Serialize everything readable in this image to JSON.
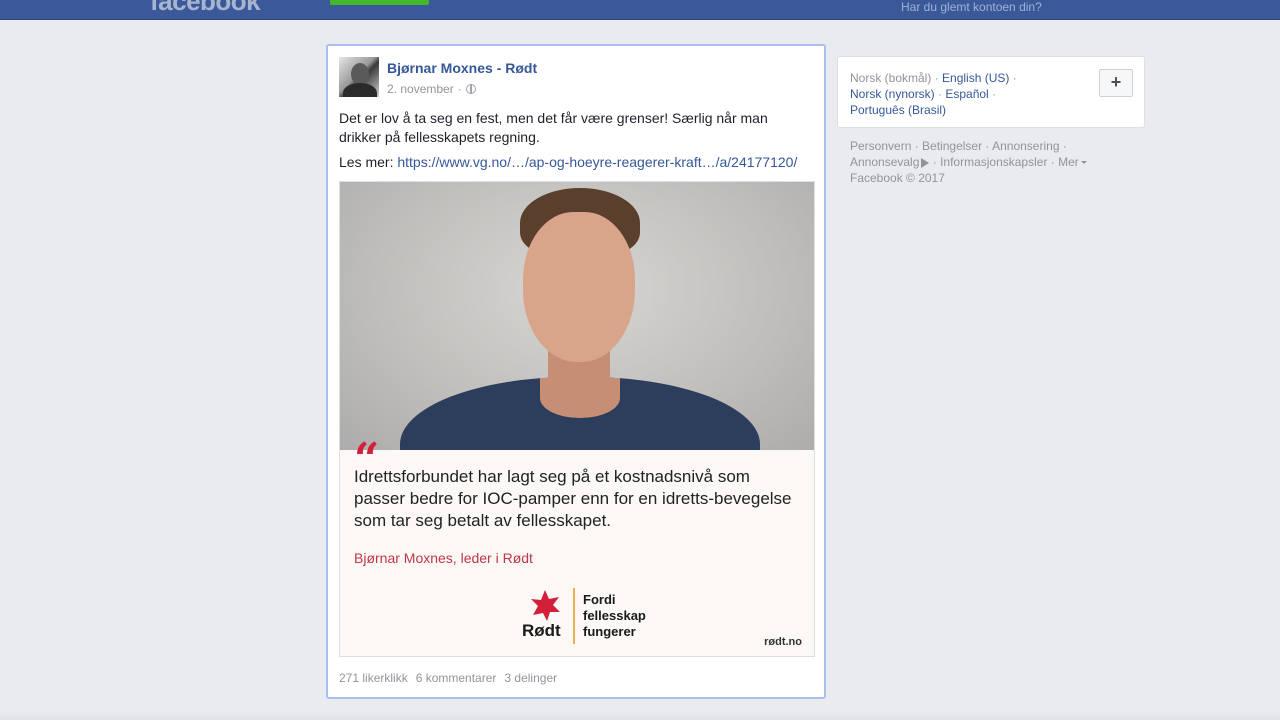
{
  "topbar": {
    "logo": "facebook",
    "forgot_account": "Har du glemt kontoen din?"
  },
  "post": {
    "author": "Bjørnar Moxnes - Rødt",
    "date": "2. november",
    "separator": "·",
    "privacy_icon": "globe-icon",
    "text": "Det er lov å ta seg en fest, men det får være grenser! Særlig når man drikker på fellesskapets regning.",
    "link_prefix": "Les mer:",
    "link_text": "https://www.vg.no/…/ap-og-hoeyre-reagerer-kraft…/a/24177120/",
    "image": {
      "quote_mark": "“",
      "quote": "Idrettsforbundet har lagt seg på et kostnadsnivå som passer bedre for IOC-pamper enn for en idretts-bevegelse som tar seg betalt av fellesskapet.",
      "attribution": "Bjørnar Moxnes, leder i Rødt",
      "party": "Rødt",
      "slogan": "Fordi fellesskap fungerer",
      "site": "rødt.no"
    },
    "likes": "271 likerklikk",
    "comments": "6 kommentarer",
    "shares": "3 delinger"
  },
  "sidebar": {
    "languages": {
      "current": "Norsk (bokmål)",
      "items": [
        "English (US)",
        "Norsk (nynorsk)",
        "Español",
        "Português (Brasil)"
      ],
      "add_label": "+"
    },
    "footer": {
      "links": [
        "Personvern",
        "Betingelser",
        "Annonsering",
        "Annonsevalg",
        "Informasjonskapsler",
        "Mer"
      ],
      "copyright": "Facebook © 2017"
    }
  },
  "colors": {
    "brand": "#3b5998",
    "link": "#365899",
    "accent_red": "#d31f3a",
    "signup_green": "#42b72a"
  }
}
